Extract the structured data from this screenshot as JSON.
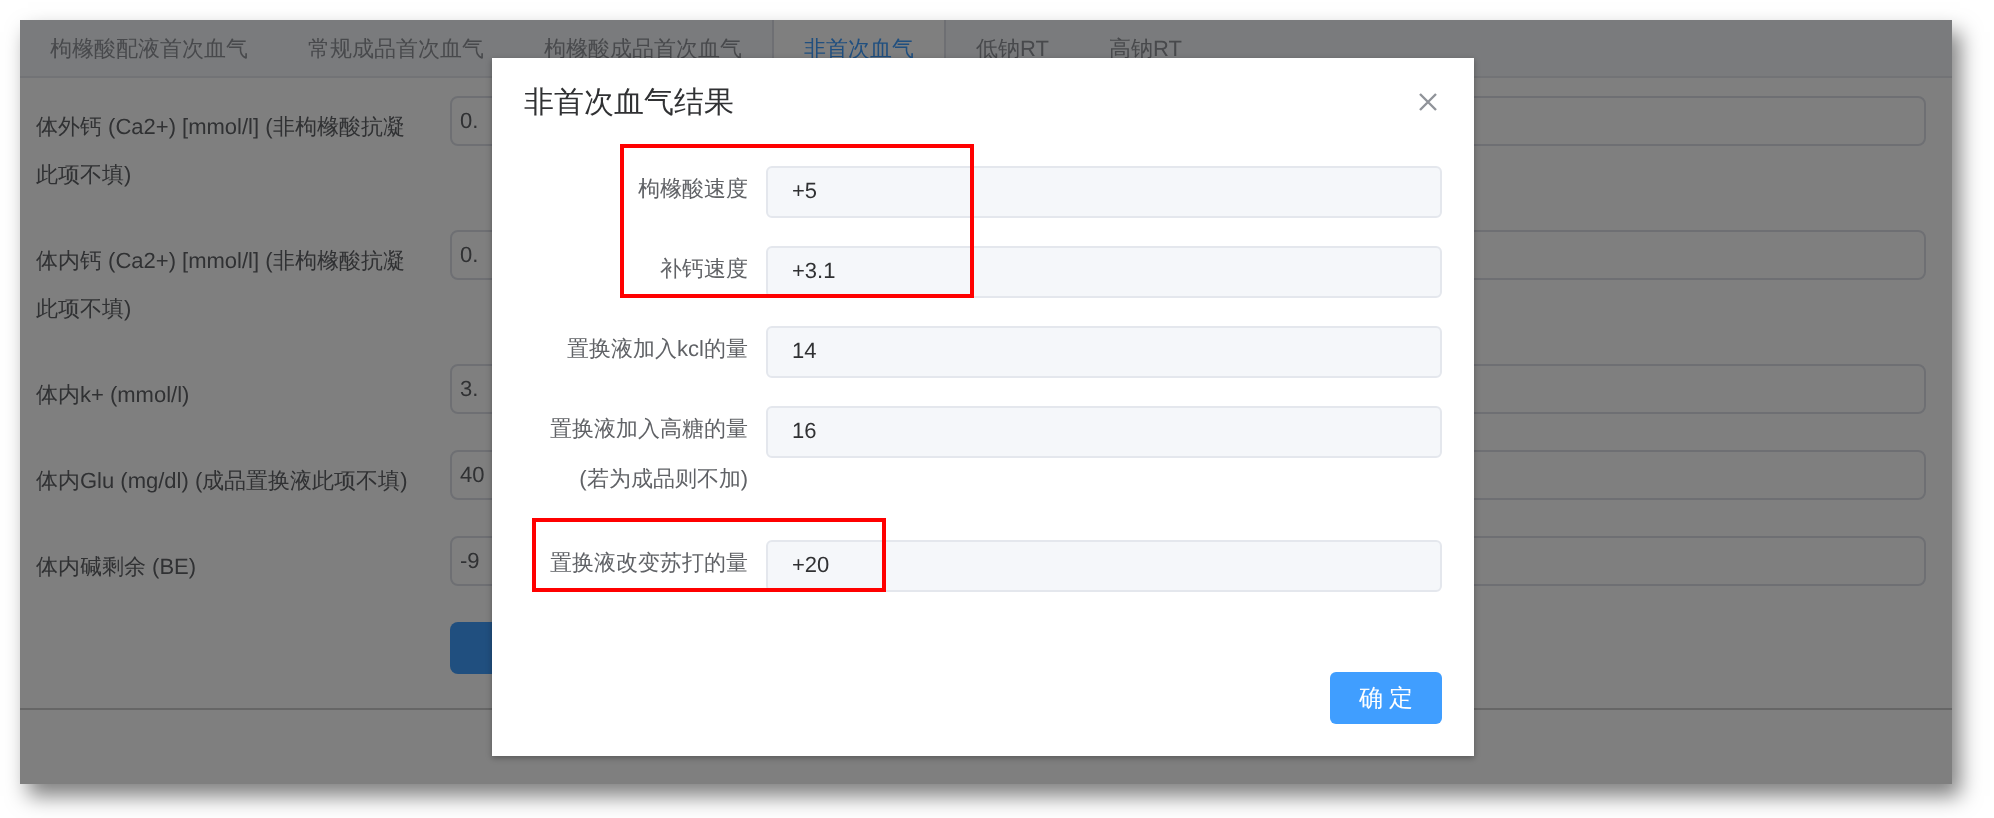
{
  "tabs": [
    {
      "label": "枸橼酸配液首次血气",
      "selected": false
    },
    {
      "label": "常规成品首次血气",
      "selected": false
    },
    {
      "label": "枸橼酸成品首次血气",
      "selected": false
    },
    {
      "label": "非首次血气",
      "selected": true
    },
    {
      "label": "低钠RT",
      "selected": false
    },
    {
      "label": "高钠RT",
      "selected": false
    }
  ],
  "form": {
    "fields": [
      {
        "label": "体外钙 (Ca2+) [mmol/l] (非枸橼酸抗凝此项不填)",
        "value": "0."
      },
      {
        "label": "体内钙 (Ca2+) [mmol/l] (非枸橼酸抗凝此项不填)",
        "value": "0."
      },
      {
        "label": "体内k+ (mmol/l)",
        "value": "3."
      },
      {
        "label": "体内Glu (mg/dl) (成品置换液此项不填)",
        "value": "40"
      },
      {
        "label": "体内碱剩余 (BE)",
        "value": "-9"
      }
    ]
  },
  "dialog": {
    "title": "非首次血气结果",
    "groups": [
      {
        "highlighted": true,
        "fields": [
          {
            "label": "枸橼酸速度",
            "value": "+5"
          },
          {
            "label": "补钙速度",
            "value": "+3.1"
          }
        ]
      },
      {
        "highlighted": false,
        "fields": [
          {
            "label": "置换液加入kcl的量",
            "value": "14"
          }
        ]
      },
      {
        "highlighted": false,
        "fields": [
          {
            "label": "置换液加入高糖的量(若为成品则不加)",
            "value": "16"
          }
        ]
      },
      {
        "highlighted": true,
        "fields": [
          {
            "label": "置换液改变苏打的量",
            "value": "+20"
          }
        ]
      }
    ],
    "confirm_button": "确 定"
  }
}
